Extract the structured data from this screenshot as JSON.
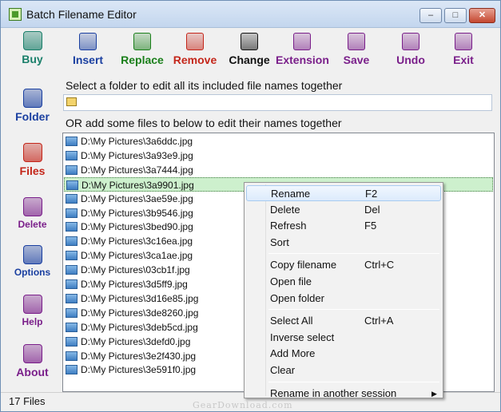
{
  "window": {
    "title": "Batch Filename Editor"
  },
  "colors": {
    "green": "#1a7f1a",
    "blue": "#1a3fa0",
    "red": "#c4261a",
    "purple": "#7a1f8a",
    "accent": "#c4262a"
  },
  "sidebar": {
    "items": [
      {
        "label": "Buy",
        "icon": "buy-icon",
        "color": "#1a7f6a"
      },
      {
        "label": "Folder",
        "icon": "folder-icon",
        "color": "#1a3fa0"
      },
      {
        "label": "Files",
        "icon": "files-icon",
        "color": "#c4261a"
      },
      {
        "label": "Delete",
        "icon": "delete-icon",
        "color": "#7a1f8a"
      },
      {
        "label": "Options",
        "icon": "options-icon",
        "color": "#1a3fa0"
      },
      {
        "label": "Help",
        "icon": "help-icon",
        "color": "#7a1f8a"
      },
      {
        "label": "About",
        "icon": "about-icon",
        "color": "#7a1f8a"
      }
    ]
  },
  "toolbar": {
    "buttons": [
      {
        "label": "Insert",
        "icon": "insert-icon",
        "color": "#1a3fa0"
      },
      {
        "label": "Replace",
        "icon": "replace-icon",
        "color": "#1a7f1a"
      },
      {
        "label": "Remove",
        "icon": "remove-icon",
        "color": "#c4261a"
      },
      {
        "label": "Change",
        "icon": "change-icon",
        "color": "#111111"
      },
      {
        "label": "Extension",
        "icon": "extension-icon",
        "color": "#7a1f8a"
      },
      {
        "label": "Save",
        "icon": "save-icon",
        "color": "#7a1f8a"
      },
      {
        "label": "Undo",
        "icon": "undo-icon",
        "color": "#7a1f8a"
      },
      {
        "label": "Exit",
        "icon": "exit-icon",
        "color": "#7a1f8a"
      }
    ]
  },
  "folder": {
    "label": "Select a folder to edit all its included file names together",
    "value": ""
  },
  "files": {
    "label": "OR add some files to below to edit their names together",
    "items": [
      "D:\\My Pictures\\3a6ddc.jpg",
      "D:\\My Pictures\\3a93e9.jpg",
      "D:\\My Pictures\\3a7444.jpg",
      "D:\\My Pictures\\3a9901.jpg",
      "D:\\My Pictures\\3ae59e.jpg",
      "D:\\My Pictures\\3b9546.jpg",
      "D:\\My Pictures\\3bed90.jpg",
      "D:\\My Pictures\\3c16ea.jpg",
      "D:\\My Pictures\\3ca1ae.jpg",
      "D:\\My Pictures\\03cb1f.jpg",
      "D:\\My Pictures\\3d5ff9.jpg",
      "D:\\My Pictures\\3d16e85.jpg",
      "D:\\My Pictures\\3de8260.jpg",
      "D:\\My Pictures\\3deb5cd.jpg",
      "D:\\My Pictures\\3defd0.jpg",
      "D:\\My Pictures\\3e2f430.jpg",
      "D:\\My Pictures\\3e591f0.jpg"
    ],
    "selected_index": 3
  },
  "status": {
    "text": "17 Files"
  },
  "context_menu": {
    "groups": [
      [
        {
          "label": "Rename",
          "shortcut": "F2"
        },
        {
          "label": "Delete",
          "shortcut": "Del"
        },
        {
          "label": "Refresh",
          "shortcut": "F5"
        },
        {
          "label": "Sort",
          "shortcut": ""
        }
      ],
      [
        {
          "label": "Copy filename",
          "shortcut": "Ctrl+C"
        },
        {
          "label": "Open file",
          "shortcut": ""
        },
        {
          "label": "Open folder",
          "shortcut": ""
        }
      ],
      [
        {
          "label": "Select All",
          "shortcut": "Ctrl+A"
        },
        {
          "label": "Inverse select",
          "shortcut": ""
        },
        {
          "label": "Add More",
          "shortcut": ""
        },
        {
          "label": "Clear",
          "shortcut": ""
        }
      ],
      [
        {
          "label": "Rename in another session",
          "shortcut": "",
          "submenu": true
        }
      ]
    ],
    "highlighted": "Rename"
  },
  "watermark": {
    "text": "GearDownload.com"
  }
}
